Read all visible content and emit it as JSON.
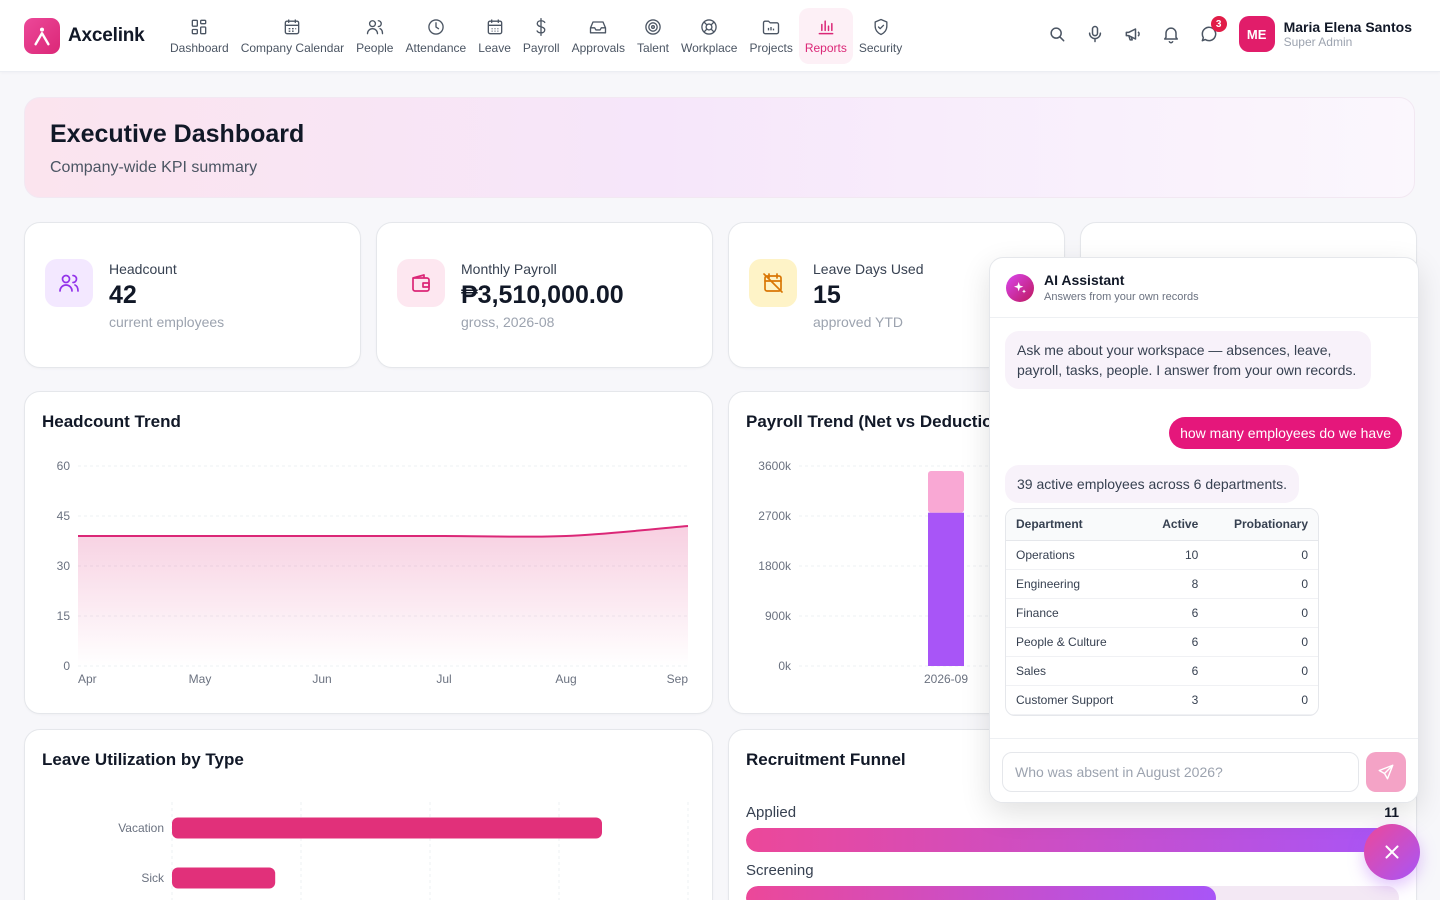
{
  "brand": {
    "name": "Axcelink"
  },
  "nav": [
    {
      "label": "Dashboard",
      "icon": "grid-icon"
    },
    {
      "label": "Company Calendar",
      "icon": "calendar-icon"
    },
    {
      "label": "People",
      "icon": "users-icon"
    },
    {
      "label": "Attendance",
      "icon": "clock-icon"
    },
    {
      "label": "Leave",
      "icon": "calendar-days-icon"
    },
    {
      "label": "Payroll",
      "icon": "dollar-icon"
    },
    {
      "label": "Approvals",
      "icon": "inbox-icon"
    },
    {
      "label": "Talent",
      "icon": "target-icon"
    },
    {
      "label": "Workplace",
      "icon": "lifebuoy-icon"
    },
    {
      "label": "Projects",
      "icon": "folder-icon"
    },
    {
      "label": "Reports",
      "icon": "bar-chart-icon",
      "active": true
    },
    {
      "label": "Security",
      "icon": "shield-icon"
    }
  ],
  "topbar": {
    "notification_count": "3",
    "user": {
      "initials": "ME",
      "name": "Maria Elena Santos",
      "role": "Super Admin"
    }
  },
  "hero": {
    "title": "Executive Dashboard",
    "subtitle": "Company-wide KPI summary"
  },
  "kpis": [
    {
      "label": "Headcount",
      "value": "42",
      "sub": "current employees",
      "icon": "users-icon",
      "tint": "#f3e8ff",
      "color": "#9333ea"
    },
    {
      "label": "Monthly Payroll",
      "value": "₱3,510,000.00",
      "sub": "gross, 2026-08",
      "icon": "wallet-icon",
      "tint": "#fde7f0",
      "color": "#db2777"
    },
    {
      "label": "Leave Days Used",
      "value": "15",
      "sub": "approved YTD",
      "icon": "calendar-off-icon",
      "tint": "#fef3c7",
      "color": "#d97706"
    }
  ],
  "headcount_panel": {
    "title": "Headcount Trend"
  },
  "payroll_panel": {
    "title": "Payroll Trend (Net vs Deduction"
  },
  "leave_panel": {
    "title": "Leave Utilization by Type"
  },
  "funnel_panel": {
    "title": "Recruitment Funnel",
    "stages": [
      {
        "label": "Applied",
        "count": "11",
        "pct": 1.0
      },
      {
        "label": "Screening",
        "count": "",
        "pct": 0.72
      }
    ]
  },
  "chart_data": [
    {
      "type": "area",
      "title": "Headcount Trend",
      "x": [
        "Apr",
        "May",
        "Jun",
        "Jul",
        "Aug",
        "Sep"
      ],
      "values": [
        39,
        39,
        39,
        39,
        39,
        42
      ],
      "yticks": [
        "0",
        "15",
        "30",
        "45",
        "60"
      ],
      "ylim": [
        0,
        60
      ],
      "color": "#db2777"
    },
    {
      "type": "bar",
      "title": "Payroll Trend (Net vs Deduction",
      "categories": [
        "2026-09"
      ],
      "series": [
        {
          "values": [
            2760000
          ],
          "color": "#a855f7"
        },
        {
          "values": [
            750000
          ],
          "color": "#f9a8d4"
        }
      ],
      "stacked": true,
      "yticks": [
        "0k",
        "900k",
        "1800k",
        "2700k",
        "3600k"
      ],
      "ylim": [
        0,
        3600000
      ]
    },
    {
      "type": "bar",
      "orientation": "horizontal",
      "title": "Leave Utilization by Type",
      "categories": [
        "Vacation",
        "Sick"
      ],
      "values": [
        10,
        2.4
      ],
      "xlim": [
        0,
        12
      ],
      "color": "#e1307a"
    }
  ],
  "assistant": {
    "title": "AI Assistant",
    "subtitle": "Answers from your own records",
    "intro": "Ask me about your workspace — absences, leave, payroll, tasks, people. I answer from your own records.",
    "user_message": "how many employees do we have",
    "answer": "39 active employees across 6 departments.",
    "table": {
      "headers": [
        "Department",
        "Active",
        "Probationary"
      ],
      "rows": [
        [
          "Operations",
          "10",
          "0"
        ],
        [
          "Engineering",
          "8",
          "0"
        ],
        [
          "Finance",
          "6",
          "0"
        ],
        [
          "People & Culture",
          "6",
          "0"
        ],
        [
          "Sales",
          "6",
          "0"
        ],
        [
          "Customer Support",
          "3",
          "0"
        ]
      ]
    },
    "input_placeholder": "Who was absent in August 2026?"
  }
}
